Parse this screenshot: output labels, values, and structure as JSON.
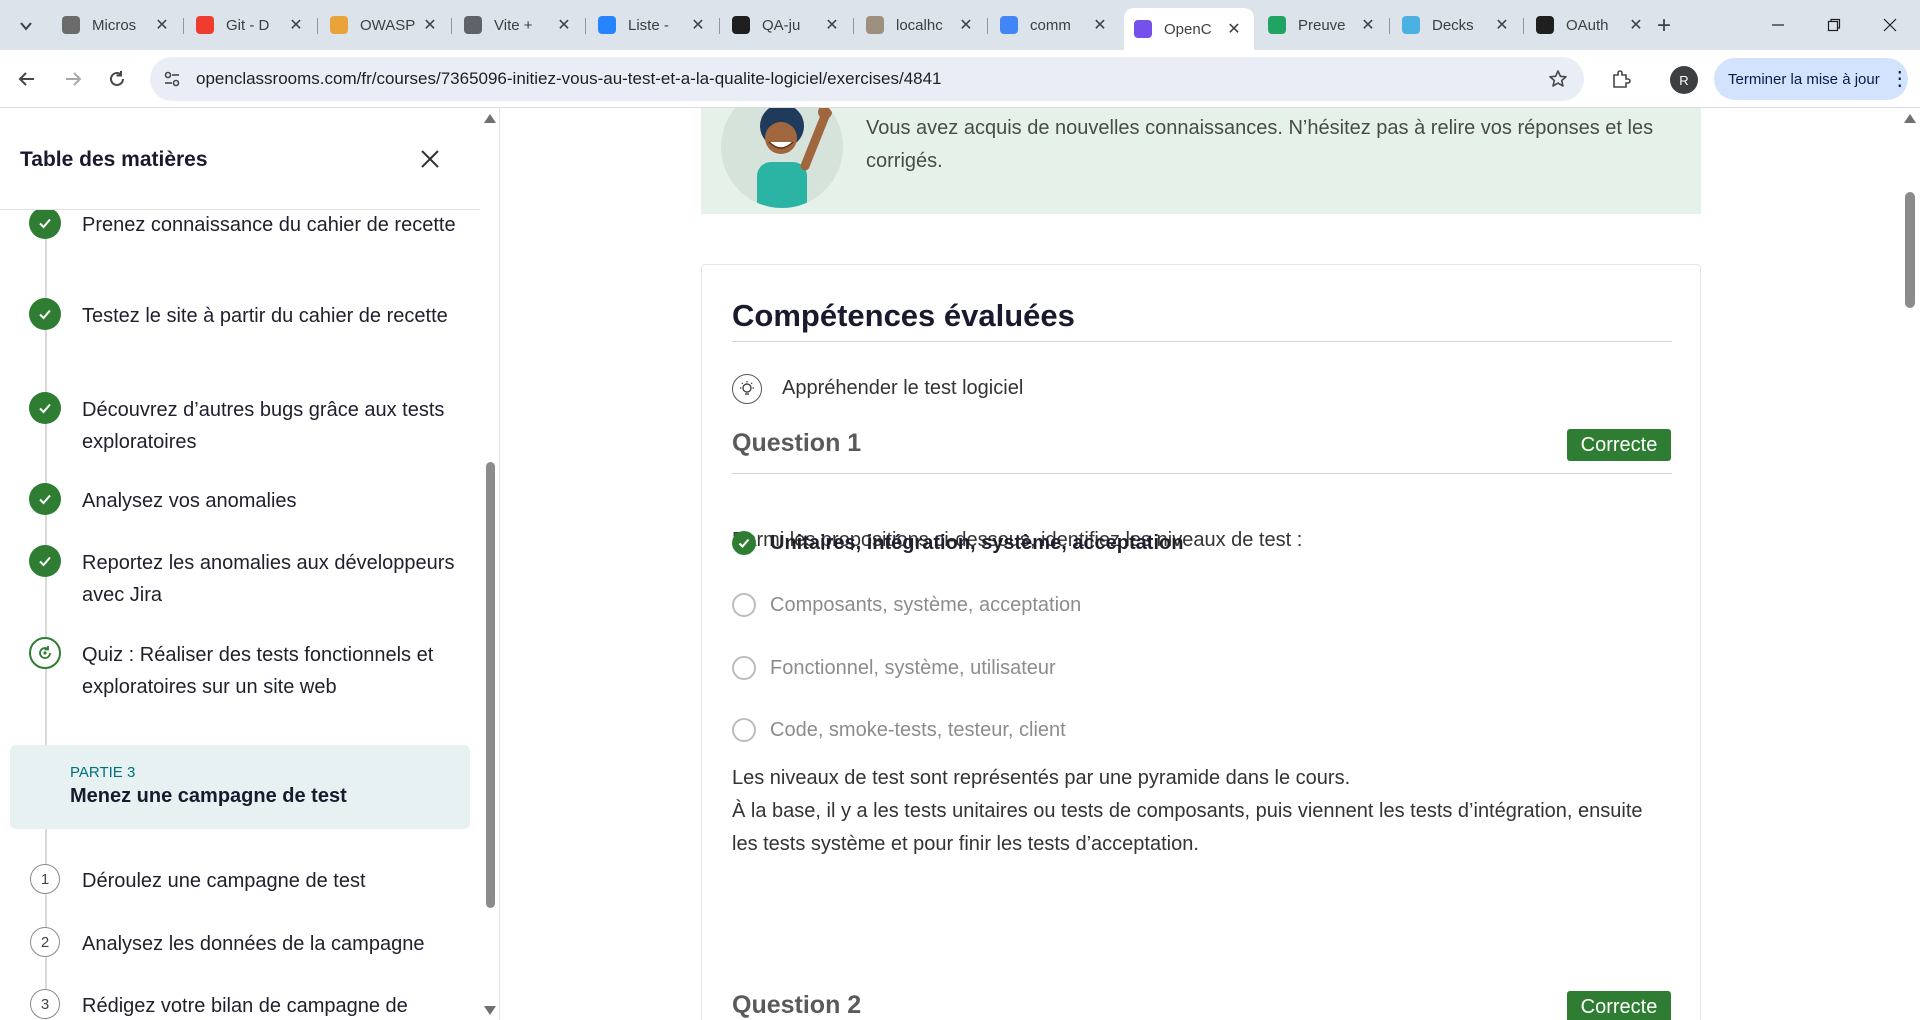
{
  "browser": {
    "tabs": [
      {
        "title": "Micros",
        "icon": "microsoft-icon",
        "color": "#6b6b6b"
      },
      {
        "title": "Git - D",
        "icon": "git-icon",
        "color": "#f03c2e"
      },
      {
        "title": "OWASP",
        "icon": "owasp-icon",
        "color": "#e8a33a"
      },
      {
        "title": "Vite +",
        "icon": "globe-icon",
        "color": "#5f6368"
      },
      {
        "title": "Liste -",
        "icon": "jira-icon",
        "color": "#2684ff"
      },
      {
        "title": "QA-ju",
        "icon": "github-icon",
        "color": "#1f1f1f"
      },
      {
        "title": "localhc",
        "icon": "localhost-icon",
        "color": "#9e8e7e"
      },
      {
        "title": "comm",
        "icon": "google-icon",
        "color": "#4285f4"
      },
      {
        "title": "OpenC",
        "icon": "openclassrooms-icon",
        "color": "#7451eb"
      },
      {
        "title": "Preuve",
        "icon": "google-drive-icon",
        "color": "#1fa463"
      },
      {
        "title": "Decks",
        "icon": "decks-icon",
        "color": "#4ab1e2"
      },
      {
        "title": "OAuth",
        "icon": "github-icon",
        "color": "#1f1f1f"
      }
    ],
    "active_tab_index": 8,
    "url": "openclassrooms.com/fr/courses/7365096-initiez-vous-au-test-et-a-la-qualite-logiciel/exercises/4841",
    "profile_initial": "R",
    "update_button": "Terminer la mise à jour"
  },
  "sidebar": {
    "title": "Table des matières",
    "chapters_done": [
      "Prenez connaissance du cahier de recette",
      "Testez le site à partir du cahier de recette",
      "Découvrez d’autres bugs grâce aux tests exploratoires",
      "Analysez vos anomalies",
      "Reportez les anomalies aux développeurs avec Jira",
      "Quiz : Réaliser des tests fonctionnels et exploratoires sur un site web"
    ],
    "part": {
      "label": "PARTIE 3",
      "title": "Menez une campagne de test"
    },
    "chapters_next": [
      {
        "num": "1",
        "title": "Déroulez une campagne de test"
      },
      {
        "num": "2",
        "title": "Analysez les données de la campagne"
      },
      {
        "num": "3",
        "title": "Rédigez votre bilan de campagne de"
      }
    ]
  },
  "main": {
    "banner_text": "Vous avez acquis de nouvelles connaissances. N’hésitez pas à relire vos réponses et les corrigés.",
    "competences_title": "Compétences évaluées",
    "skill": "Appréhender le test logiciel",
    "question1": {
      "title": "Question 1",
      "status": "Correcte",
      "text": "Parmi les propositions ci-dessous, identifiez les niveaux de test :",
      "options": [
        "Unitaires, intégration, système, acceptation",
        "Composants, système, acceptation",
        "Fonctionnel, système, utilisateur",
        "Code, smoke-tests, testeur, client"
      ],
      "correct_index": 0,
      "explanation_line1": "Les niveaux de test sont représentés par une pyramide dans le cours.",
      "explanation_line2": "À la base, il y a les tests unitaires ou tests de composants, puis viennent les tests d’intégration, ensuite les tests système et pour finir les tests d’acceptation."
    },
    "question2": {
      "title": "Question 2",
      "status": "Correcte"
    }
  },
  "colors": {
    "accent_green": "#2e7d32",
    "banner_bg": "#e6f1ea",
    "part_bg": "#e7f1f2"
  }
}
